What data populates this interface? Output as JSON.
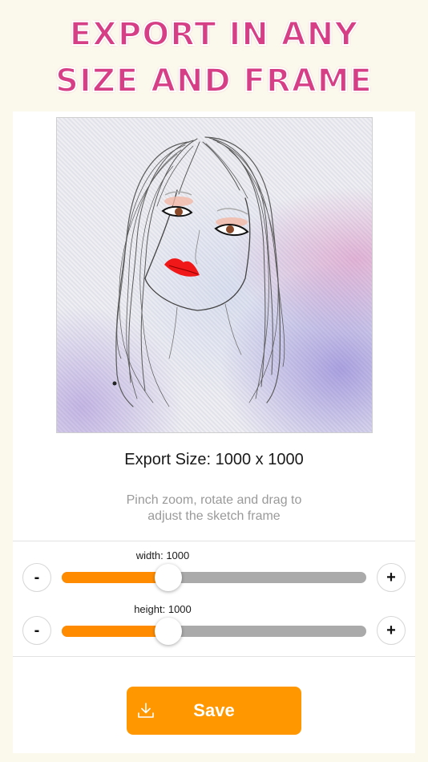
{
  "headline": {
    "line1": "Export in any",
    "line2": "size and frame"
  },
  "export": {
    "size_label": "Export Size: 1000 x 1000"
  },
  "hint": {
    "line1": "Pinch zoom, rotate and drag to",
    "line2": "adjust the sketch frame"
  },
  "sliders": {
    "width": {
      "label": "width: 1000",
      "minus": "-",
      "plus": "+",
      "level_percent": 35
    },
    "height": {
      "label": "height: 1000",
      "minus": "-",
      "plus": "+",
      "level_percent": 35
    }
  },
  "save": {
    "label": "Save",
    "icon": "download-icon"
  },
  "colors": {
    "accent": "#ff9800",
    "slider_fill": "#ff8c00",
    "slider_track": "#aaaaaa",
    "headline": "#d63f86",
    "background": "#fbf8ec"
  }
}
